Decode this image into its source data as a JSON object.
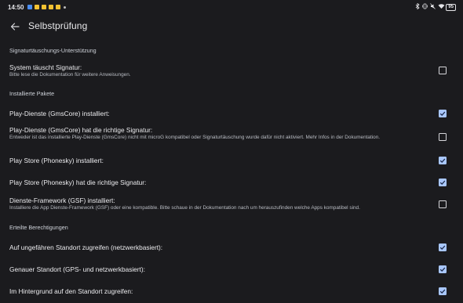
{
  "status_bar": {
    "time": "14:50",
    "notification_icons": [
      "app-notification-icon",
      "app-notification-icon",
      "app-notification-icon",
      "app-notification-icon",
      "app-notification-icon"
    ],
    "battery": "95"
  },
  "app_bar": {
    "title": "Selbstprüfung"
  },
  "sections": {
    "spoofing": {
      "header": "Signaturtäuschungs-Unterstützung",
      "items": [
        {
          "title": "System täuscht Signatur:",
          "subtitle": "Bitte lese die Dokumentation für weitere Anweisungen.",
          "checked": false
        }
      ]
    },
    "packages": {
      "header": "Installierte Pakete",
      "items": [
        {
          "title": "Play-Dienste (GmsCore) installiert:",
          "subtitle": "",
          "checked": true
        },
        {
          "title": "Play-Dienste (GmsCore) hat die richtige Signatur:",
          "subtitle": "Entweder ist das installierte Play-Dienste (GmsCore) nicht mit microG kompatibel oder Signaturtäuschung wurde dafür nicht aktiviert. Mehr Infos in der Dokumentation.",
          "checked": false
        },
        {
          "title": "Play Store (Phonesky) installiert:",
          "subtitle": "",
          "checked": true
        },
        {
          "title": "Play Store (Phonesky) hat die richtige Signatur:",
          "subtitle": "",
          "checked": true
        },
        {
          "title": "Dienste-Framework (GSF) installiert:",
          "subtitle": "Installiere die App Dienste-Framework (GSF) oder eine kompatible. Bitte schaue in der Dokumentation nach um herauszufinden welche Apps kompatibel sind.",
          "checked": false
        }
      ]
    },
    "permissions": {
      "header": "Erteilte Berechtigungen",
      "items": [
        {
          "title": "Auf ungefähren Standort zugreifen (netzwerkbasiert):",
          "subtitle": "",
          "checked": true
        },
        {
          "title": "Genauer Standort (GPS- und netzwerkbasiert):",
          "subtitle": "",
          "checked": true
        },
        {
          "title": "Im Hintergrund auf den Standort zugreifen:",
          "subtitle": "",
          "checked": true
        }
      ]
    }
  },
  "colors": {
    "background": "#1b1b1e",
    "checkbox_checked": "#a9c7ff",
    "text_primary": "#ececef",
    "text_secondary": "#b9bcc3"
  }
}
